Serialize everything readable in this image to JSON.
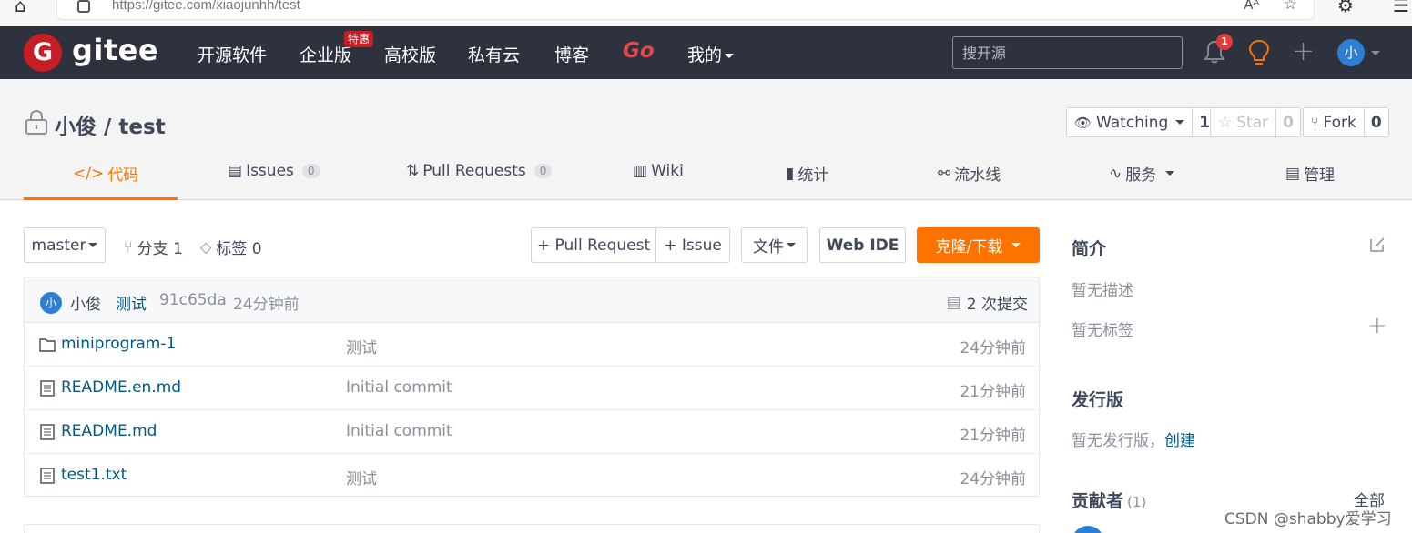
{
  "browser": {
    "url": "https://gitee.com/xiaojunhh/test",
    "reader_label": "Aᴬ"
  },
  "nav": {
    "logo_letter": "G",
    "logo_text": "gitee",
    "items": [
      "开源软件",
      "企业版",
      "高校版",
      "私有云",
      "博客"
    ],
    "hot_badge": "特惠",
    "go_label": "Go",
    "mine_label": "我的",
    "search_placeholder": "搜开源",
    "notification_count": "1",
    "avatar_letter": "小"
  },
  "repo": {
    "title": "小俊 / test",
    "watch_label": "Watching",
    "watch_count": "1",
    "star_label": "Star",
    "star_count": "0",
    "fork_label": "Fork",
    "fork_count": "0"
  },
  "tabs": [
    {
      "label": "代码",
      "count": ""
    },
    {
      "label": "Issues",
      "count": "0"
    },
    {
      "label": "Pull Requests",
      "count": "0"
    },
    {
      "label": "Wiki",
      "count": ""
    },
    {
      "label": "统计",
      "count": ""
    },
    {
      "label": "流水线",
      "count": ""
    },
    {
      "label": "服务",
      "count": ""
    },
    {
      "label": "管理",
      "count": ""
    }
  ],
  "toolbar": {
    "branch": "master",
    "branches_label": "分支 1",
    "tags_label": "标签 0",
    "pull_request": "+ Pull Request",
    "issue": "+ Issue",
    "file_menu": "文件",
    "web_ide": "Web IDE",
    "clone": "克隆/下载"
  },
  "commit": {
    "avatar_letter": "小",
    "author": "小俊",
    "message": "测试",
    "hash": "91c65da",
    "time": "24分钟前",
    "count_label": "2 次提交"
  },
  "files": [
    {
      "name": "miniprogram-1",
      "type": "folder",
      "message": "测试",
      "time": "24分钟前"
    },
    {
      "name": "README.en.md",
      "type": "file",
      "message": "Initial commit",
      "time": "21分钟前"
    },
    {
      "name": "README.md",
      "type": "file",
      "message": "Initial commit",
      "time": "21分钟前"
    },
    {
      "name": "test1.txt",
      "type": "file",
      "message": "测试",
      "time": "24分钟前"
    }
  ],
  "sidebar": {
    "intro_title": "简介",
    "no_desc": "暂无描述",
    "no_tags": "暂无标签",
    "release_title": "发行版",
    "no_release": "暂无发行版，",
    "create_link": "创建",
    "contrib_title": "贡献者",
    "contrib_count": "(1)",
    "all_link": "全部"
  },
  "watermark": "CSDN @shabby爱学习",
  "colors": {
    "nav_bg": "#2e323e",
    "accent": "#fe7300",
    "brand_red": "#c71d23",
    "link": "#005980"
  }
}
